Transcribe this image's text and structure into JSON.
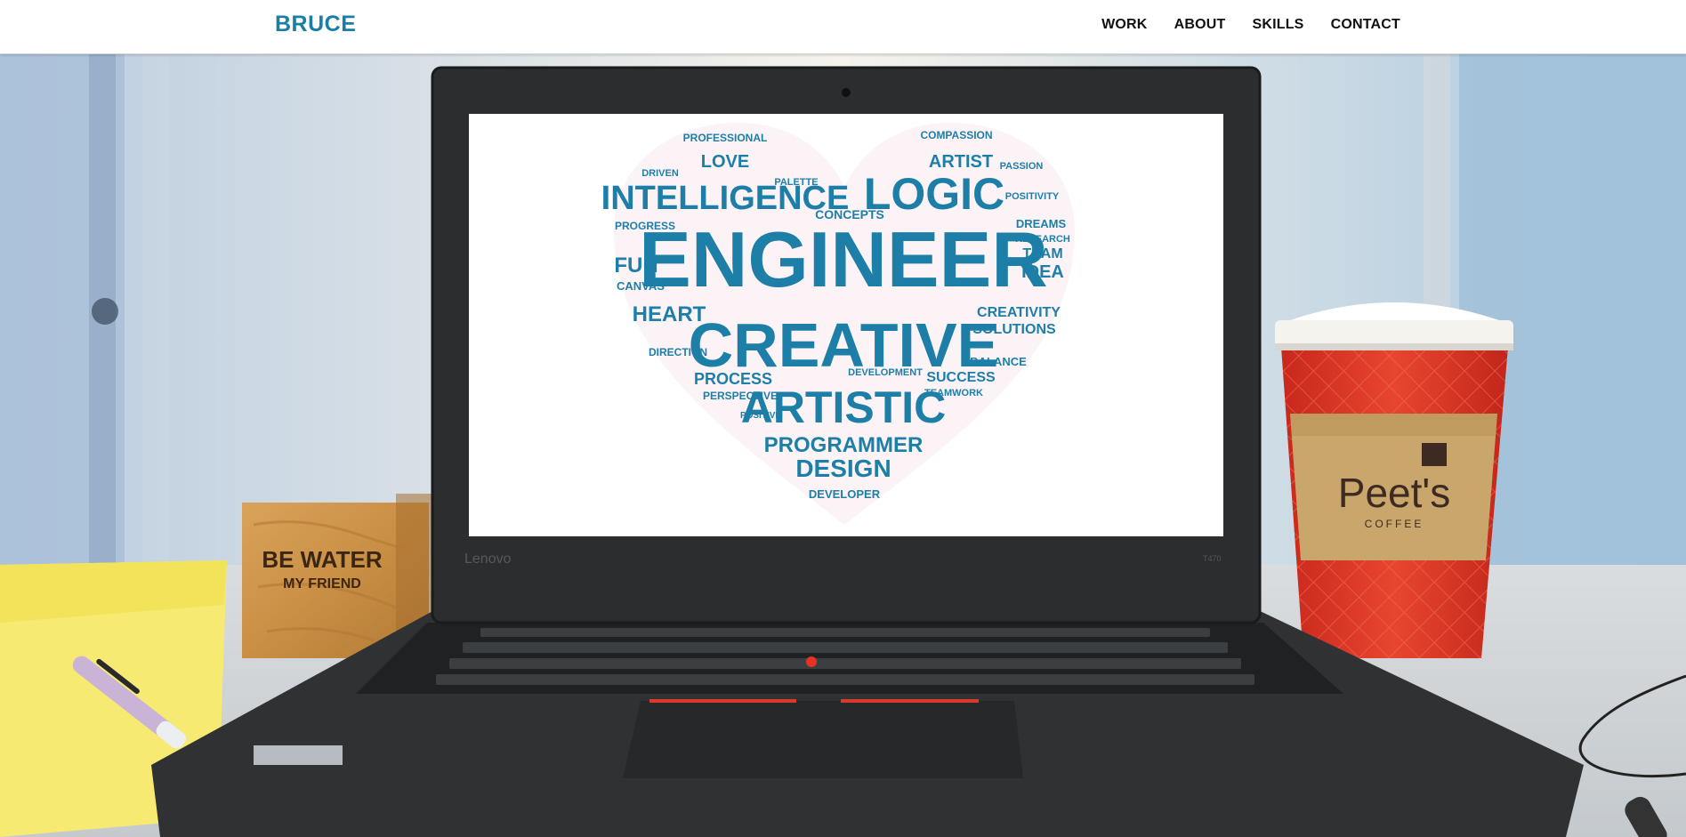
{
  "navbar": {
    "brand": "BRUCE",
    "links": [
      {
        "label": "WORK"
      },
      {
        "label": "ABOUT"
      },
      {
        "label": "SKILLS"
      },
      {
        "label": "CONTACT"
      }
    ]
  },
  "hero": {
    "cube_line1": "BE WATER",
    "cube_line2": "MY FRIEND",
    "laptop_brand": "Lenovo",
    "laptop_model": "T470",
    "cup_brand": "Peet's",
    "cup_sub": "COFFEE",
    "wordcloud": {
      "big": [
        "ENGINEER",
        "CREATIVE",
        "ARTISTIC",
        "INTELLIGENCE",
        "LOGIC",
        "LOVE",
        "ARTIST",
        "PROGRAMMER",
        "DESIGN"
      ],
      "medium": [
        "PROFESSIONAL",
        "COMPASSION",
        "DRIVEN",
        "PALETTE",
        "PASSION",
        "POSITIVITY",
        "DREAMS",
        "RESEARCH",
        "TEAM",
        "IDEA",
        "FUN",
        "HEART",
        "CREATIVITY",
        "SOLUTIONS",
        "BALANCE",
        "SUCCESS",
        "TEAMWORK",
        "PROCESS",
        "PERSPECTIVE",
        "DIRECTION",
        "CANVAS",
        "PROGRESS",
        "CONCEPTS",
        "DEVELOPER",
        "DEVELOPMENT",
        "POSITIVE"
      ]
    }
  },
  "colors": {
    "accent": "#1b7ea6",
    "wordcloud": "#1d7fa8"
  }
}
